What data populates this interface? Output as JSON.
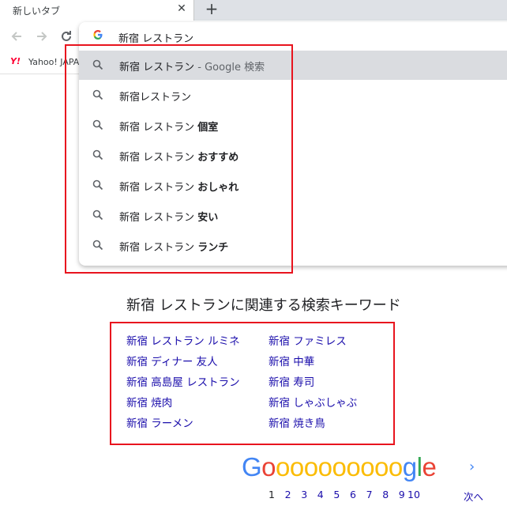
{
  "browser": {
    "tab_title": "新しいタブ",
    "tab_close": "✕",
    "new_tab": "+",
    "bookmark_label": "Yahoo! JAPA",
    "bookmark_icon_text": "Y!"
  },
  "omnibox": {
    "value": "新宿 レストラン",
    "suggestions": [
      {
        "base": "新宿 レストラン",
        "bold": "",
        "desc": " - Google 検索",
        "selected": true
      },
      {
        "base": "新宿レストラン",
        "bold": "",
        "desc": ""
      },
      {
        "base": "新宿 レストラン ",
        "bold": "個室",
        "desc": ""
      },
      {
        "base": "新宿 レストラン ",
        "bold": "おすすめ",
        "desc": ""
      },
      {
        "base": "新宿 レストラン ",
        "bold": "おしゃれ",
        "desc": ""
      },
      {
        "base": "新宿 レストラン ",
        "bold": "安い",
        "desc": ""
      },
      {
        "base": "新宿 レストラン ",
        "bold": "ランチ",
        "desc": ""
      }
    ]
  },
  "related": {
    "title": "新宿 レストランに関連する検索キーワード",
    "left": [
      "新宿 レストラン ルミネ",
      "新宿 ディナー 友人",
      "新宿 高島屋 レストラン",
      "新宿 焼肉",
      "新宿 ラーメン"
    ],
    "right": [
      "新宿 ファミレス",
      "新宿 中華",
      "新宿 寿司",
      "新宿 しゃぶしゃぶ",
      "新宿 焼き鳥"
    ]
  },
  "pagination": {
    "logo_letters": [
      "G",
      "o",
      "o",
      "o",
      "o",
      "o",
      "o",
      "o",
      "o",
      "o",
      "o",
      "g",
      "l",
      "e"
    ],
    "pages": [
      "1",
      "2",
      "3",
      "4",
      "5",
      "6",
      "7",
      "8",
      "9",
      "10"
    ],
    "current": "1",
    "next_label": "次へ",
    "next_chevron": "›"
  },
  "colors": {
    "annotation_red": "#e8141e",
    "link": "#1a0dab",
    "selected_row": "#dadce0",
    "google_blue": "#4285f4",
    "google_red": "#ea4335",
    "google_yellow": "#fbbc05",
    "google_green": "#34a853"
  }
}
